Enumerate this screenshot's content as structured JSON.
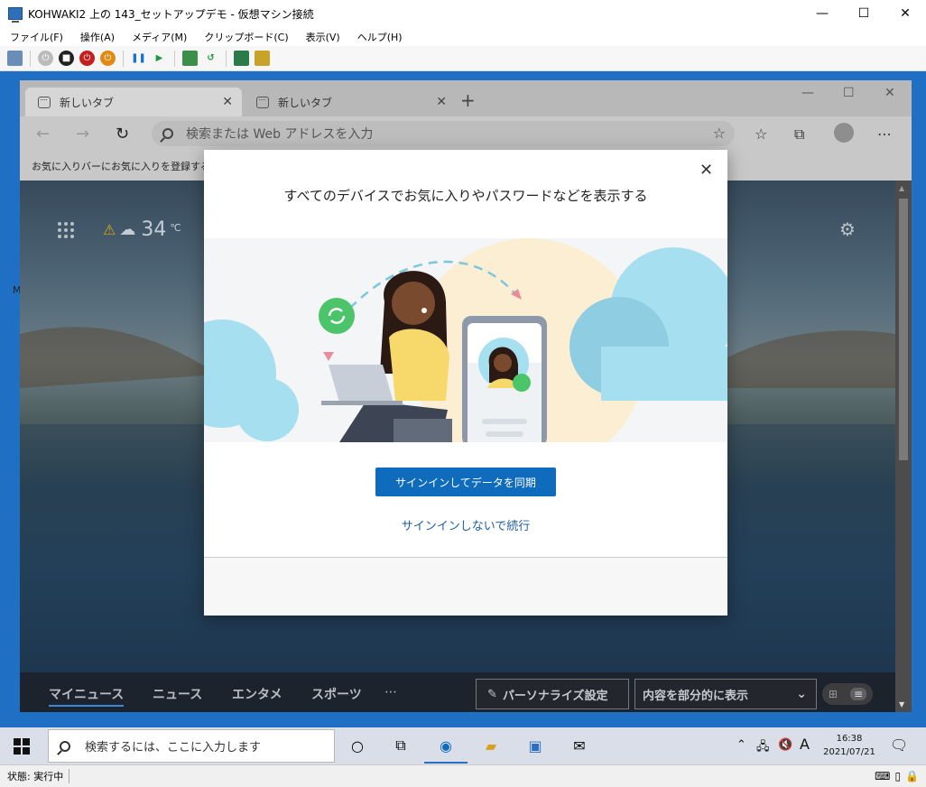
{
  "host": {
    "title": "KOHWAKI2 上の 143_セットアップデモ - 仮想マシン接続",
    "controls": {
      "minimize": "—",
      "maximize": "☐",
      "close": "✕"
    },
    "menu": [
      "ファイル(F)",
      "操作(A)",
      "メディア(M)",
      "クリップボード(C)",
      "表示(V)",
      "ヘルプ(H)"
    ],
    "status": "状態: 実行中"
  },
  "edge": {
    "tabs": [
      {
        "label": "新しいタブ"
      },
      {
        "label": "新しいタブ"
      }
    ],
    "new_tab": "+",
    "window_controls": {
      "minimize": "—",
      "maximize": "☐",
      "close": "✕"
    },
    "address_placeholder": "検索または Web アドレスを入力",
    "favorites_bar_text": "お気に入りバーにお気に入りを登録すると",
    "desktop_letter": "M",
    "weather": {
      "temp": "34",
      "unit": "℃"
    },
    "news_tabs": [
      "マイニュース",
      "ニュース",
      "エンタメ",
      "スポーツ",
      "⋯"
    ],
    "personalize_label": "パーソナライズ設定",
    "content_select_value": "内容を部分的に表示"
  },
  "dialog": {
    "title": "すべてのデバイスでお気に入りやパスワードなどを表示する",
    "primary_button": "サインインしてデータを同期",
    "secondary_link": "サインインしないで続行"
  },
  "taskbar": {
    "search_placeholder": "検索するには、ここに入力します",
    "ime": "A",
    "time": "16:38",
    "date": "2021/07/21"
  },
  "colors": {
    "accent": "#0f6cbd",
    "link": "#1e5fa3",
    "guest_border": "#1f6fc4"
  }
}
